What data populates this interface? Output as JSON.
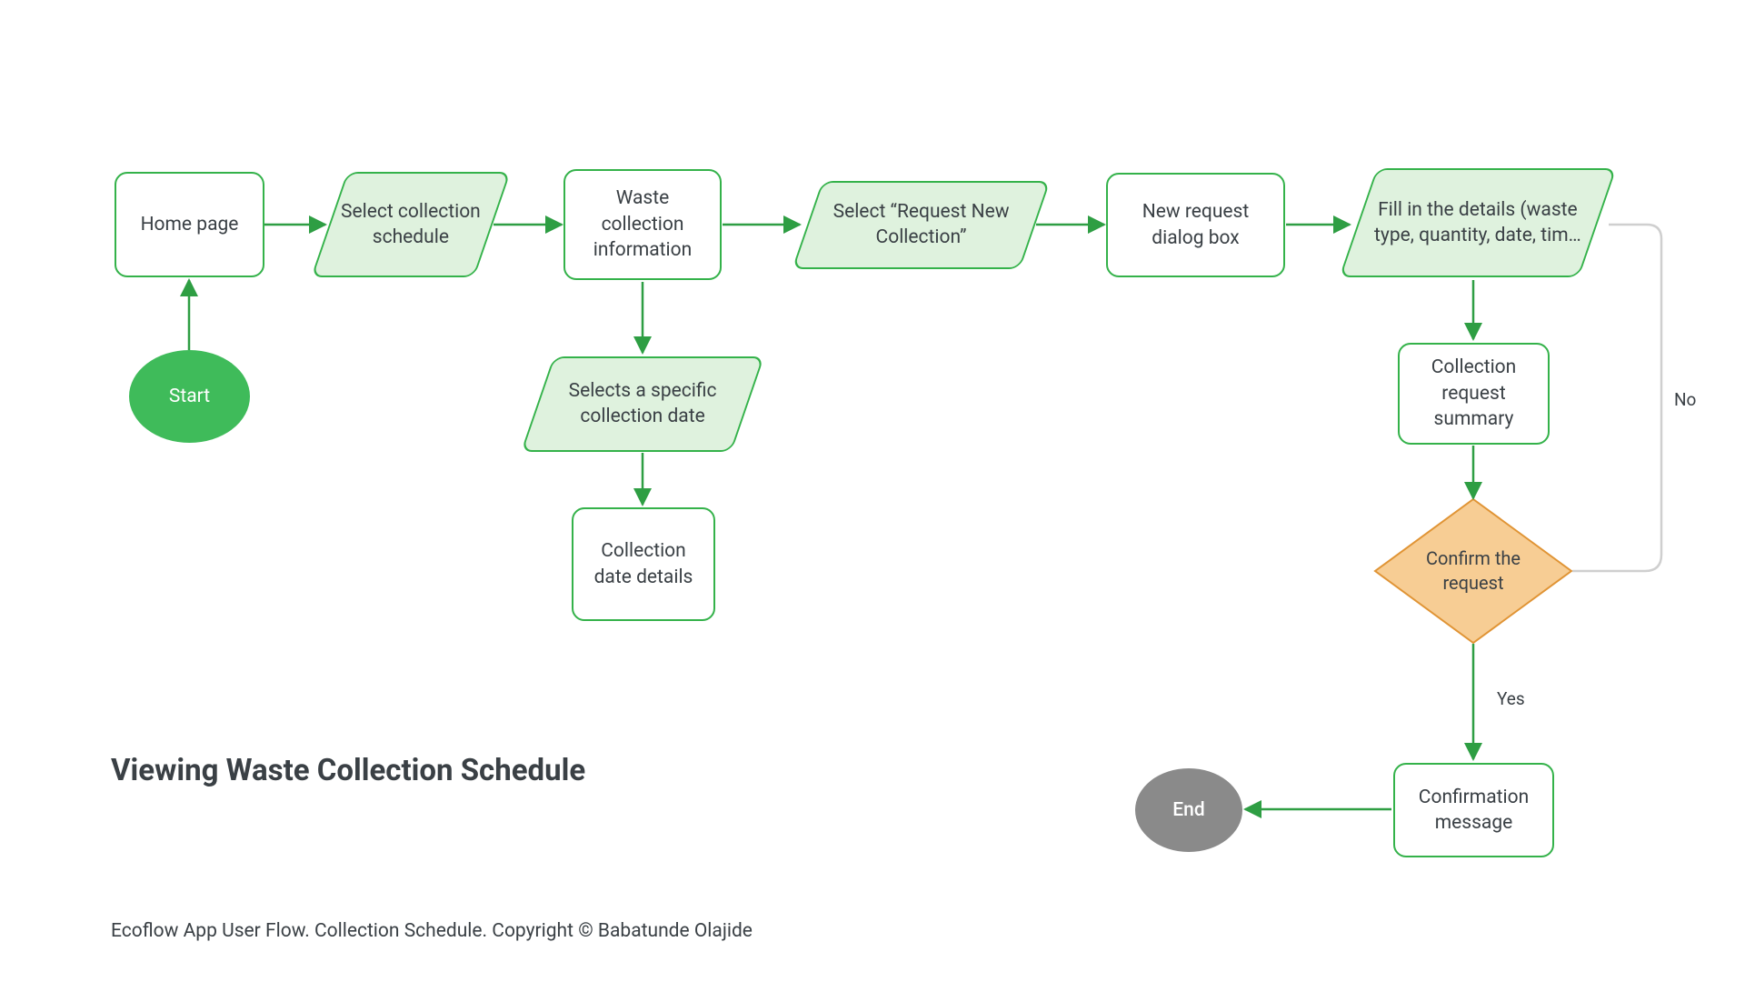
{
  "colors": {
    "green_stroke": "#34b24a",
    "green_fill": "#dff2de",
    "start_fill": "#3fbb5a",
    "end_fill": "#8a8a8a",
    "decision_stroke": "#e09435",
    "decision_fill": "#f7cd94",
    "arrow": "#2e9e43",
    "no_line": "#cfcfcf",
    "text": "#3a4045"
  },
  "nodes": {
    "start": "Start",
    "home": "Home page",
    "select_schedule": "Select collection schedule",
    "waste_info": "Waste collection information",
    "select_date": "Selects a specific collection date",
    "date_details": "Collection date details",
    "request_new": "Select “Request New Collection”",
    "dialog": "New request dialog box",
    "fill_details": "Fill in the details (waste type, quantity, date, tim…",
    "summary": "Collection request summary",
    "decision": "Confirm the request",
    "confirmation": "Confirmation message",
    "end": "End"
  },
  "edges": {
    "yes": "Yes",
    "no": "No"
  },
  "title": "Viewing Waste Collection Schedule",
  "footer": "Ecoflow App User Flow. Collection Schedule. Copyright ©  Babatunde Olajide"
}
